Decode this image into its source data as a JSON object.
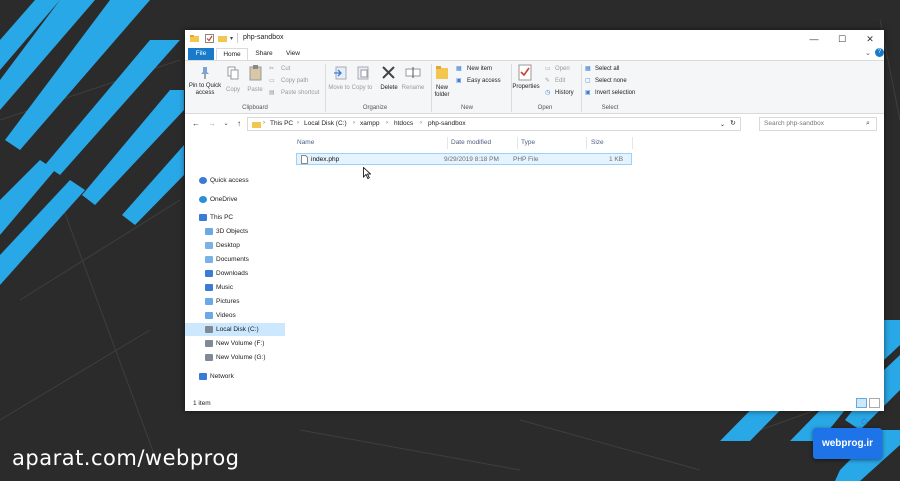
{
  "window": {
    "title": "php-sandbox",
    "controls": {
      "minimize": "—",
      "maximize": "☐",
      "close": "✕"
    }
  },
  "ribbon_tabs": [
    "File",
    "Home",
    "Share",
    "View"
  ],
  "ribbon": {
    "clipboard": {
      "label": "Clipboard",
      "pin": "Pin to Quick access",
      "copy": "Copy",
      "paste": "Paste",
      "cut": "Cut",
      "copy_path": "Copy path",
      "paste_shortcut": "Paste shortcut"
    },
    "organize": {
      "label": "Organize",
      "move_to": "Move to",
      "copy_to": "Copy to",
      "delete": "Delete",
      "rename": "Rename"
    },
    "new": {
      "label": "New",
      "new_folder": "New folder",
      "new_item": "New item",
      "easy_access": "Easy access"
    },
    "open": {
      "label": "Open",
      "properties": "Properties",
      "open": "Open",
      "edit": "Edit",
      "history": "History"
    },
    "select": {
      "label": "Select",
      "select_all": "Select all",
      "select_none": "Select none",
      "invert_selection": "Invert selection"
    }
  },
  "address": {
    "breadcrumbs": [
      "This PC",
      "Local Disk (C:)",
      "xampp",
      "htdocs",
      "php-sandbox"
    ],
    "search_placeholder": "Search php-sandbox"
  },
  "nav_pane": [
    {
      "label": "Quick access",
      "icon": "star-icon",
      "level": 0
    },
    {
      "label": "OneDrive",
      "icon": "cloud-icon",
      "level": 0
    },
    {
      "label": "This PC",
      "icon": "computer-icon",
      "level": 0
    },
    {
      "label": "3D Objects",
      "icon": "cube-icon",
      "level": 1
    },
    {
      "label": "Desktop",
      "icon": "folder-icon",
      "level": 1
    },
    {
      "label": "Documents",
      "icon": "folder-icon",
      "level": 1
    },
    {
      "label": "Downloads",
      "icon": "download-folder-icon",
      "level": 1
    },
    {
      "label": "Music",
      "icon": "music-icon",
      "level": 1
    },
    {
      "label": "Pictures",
      "icon": "picture-icon",
      "level": 1
    },
    {
      "label": "Videos",
      "icon": "video-icon",
      "level": 1
    },
    {
      "label": "Local Disk (C:)",
      "icon": "drive-icon",
      "level": 1,
      "selected": true
    },
    {
      "label": "New Volume (F:)",
      "icon": "drive-icon",
      "level": 1
    },
    {
      "label": "New Volume (G:)",
      "icon": "drive-icon",
      "level": 1
    },
    {
      "label": "Network",
      "icon": "network-icon",
      "level": 0
    }
  ],
  "columns": [
    "Name",
    "Date modified",
    "Type",
    "Size"
  ],
  "files": [
    {
      "name": "index.php",
      "date_modified": "9/29/2019 8:18 PM",
      "type": "PHP File",
      "size": "1 KB"
    }
  ],
  "status": {
    "item_count": "1 item"
  },
  "overlay": {
    "watermark": "aparat.com/webprog",
    "brand": "webprog.ir"
  },
  "colors": {
    "accent": "#1979ca",
    "selection_bg": "#cce8ff",
    "brand_blue": "#1e73e8",
    "background_dark": "#2b2b2b",
    "stripe_blue": "#29a8e8"
  }
}
